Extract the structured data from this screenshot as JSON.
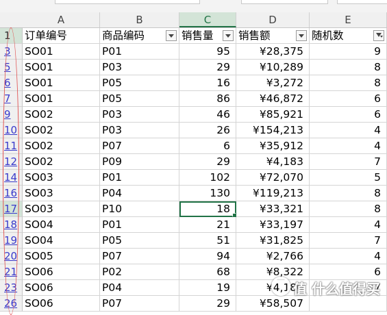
{
  "columns": [
    "A",
    "B",
    "C",
    "D",
    "E"
  ],
  "header_row": {
    "row_number": "1",
    "cells": [
      "订单编号",
      "商品编码",
      "销售量",
      "销售额",
      "随机数"
    ]
  },
  "rows": [
    {
      "row_number": "3",
      "order": "SO01",
      "product": "P01",
      "qty": "95",
      "amount": "¥28,375",
      "rand": "9"
    },
    {
      "row_number": "5",
      "order": "SO01",
      "product": "P03",
      "qty": "29",
      "amount": "¥10,289",
      "rand": "8"
    },
    {
      "row_number": "6",
      "order": "SO01",
      "product": "P05",
      "qty": "16",
      "amount": "¥3,272",
      "rand": "8"
    },
    {
      "row_number": "7",
      "order": "SO01",
      "product": "P05",
      "qty": "86",
      "amount": "¥46,872",
      "rand": "6"
    },
    {
      "row_number": "9",
      "order": "SO02",
      "product": "P03",
      "qty": "46",
      "amount": "¥85,921",
      "rand": "6"
    },
    {
      "row_number": "10",
      "order": "SO02",
      "product": "P03",
      "qty": "26",
      "amount": "¥154,213",
      "rand": "4"
    },
    {
      "row_number": "11",
      "order": "SO02",
      "product": "P07",
      "qty": "6",
      "amount": "¥35,912",
      "rand": "4"
    },
    {
      "row_number": "12",
      "order": "SO02",
      "product": "P09",
      "qty": "29",
      "amount": "¥4,183",
      "rand": "7"
    },
    {
      "row_number": "14",
      "order": "SO03",
      "product": "P01",
      "qty": "102",
      "amount": "¥72,070",
      "rand": "5"
    },
    {
      "row_number": "16",
      "order": "SO03",
      "product": "P04",
      "qty": "130",
      "amount": "¥119,213",
      "rand": "8"
    },
    {
      "row_number": "17",
      "order": "SO03",
      "product": "P10",
      "qty": "18",
      "amount": "¥33,321",
      "rand": "8"
    },
    {
      "row_number": "18",
      "order": "SO04",
      "product": "P01",
      "qty": "21",
      "amount": "¥33,197",
      "rand": "4"
    },
    {
      "row_number": "19",
      "order": "SO04",
      "product": "P05",
      "qty": "51",
      "amount": "¥31,825",
      "rand": "7"
    },
    {
      "row_number": "20",
      "order": "SO05",
      "product": "P07",
      "qty": "94",
      "amount": "¥2,766",
      "rand": "4"
    },
    {
      "row_number": "21",
      "order": "SO06",
      "product": "P02",
      "qty": "68",
      "amount": "¥8,322",
      "rand": "6"
    },
    {
      "row_number": "23",
      "order": "SO06",
      "product": "P04",
      "qty": "19",
      "amount": "¥4,180",
      "rand": "7"
    },
    {
      "row_number": "26",
      "order": "SO06",
      "product": "P07",
      "qty": "29",
      "amount": "¥58,507",
      "rand": ""
    }
  ],
  "active_row_number": "17",
  "active_column": "C",
  "filtered_column_icon": "filter-funnel-icon",
  "dropdown_icon": "dropdown-arrow-icon",
  "colors": {
    "selection_green": "#217346",
    "header_highlight": "#d3e4d7",
    "filtered_row_number": "#3a3acb",
    "annotation_red": "#e05050"
  },
  "watermark": {
    "text": "值 什么值得买"
  }
}
